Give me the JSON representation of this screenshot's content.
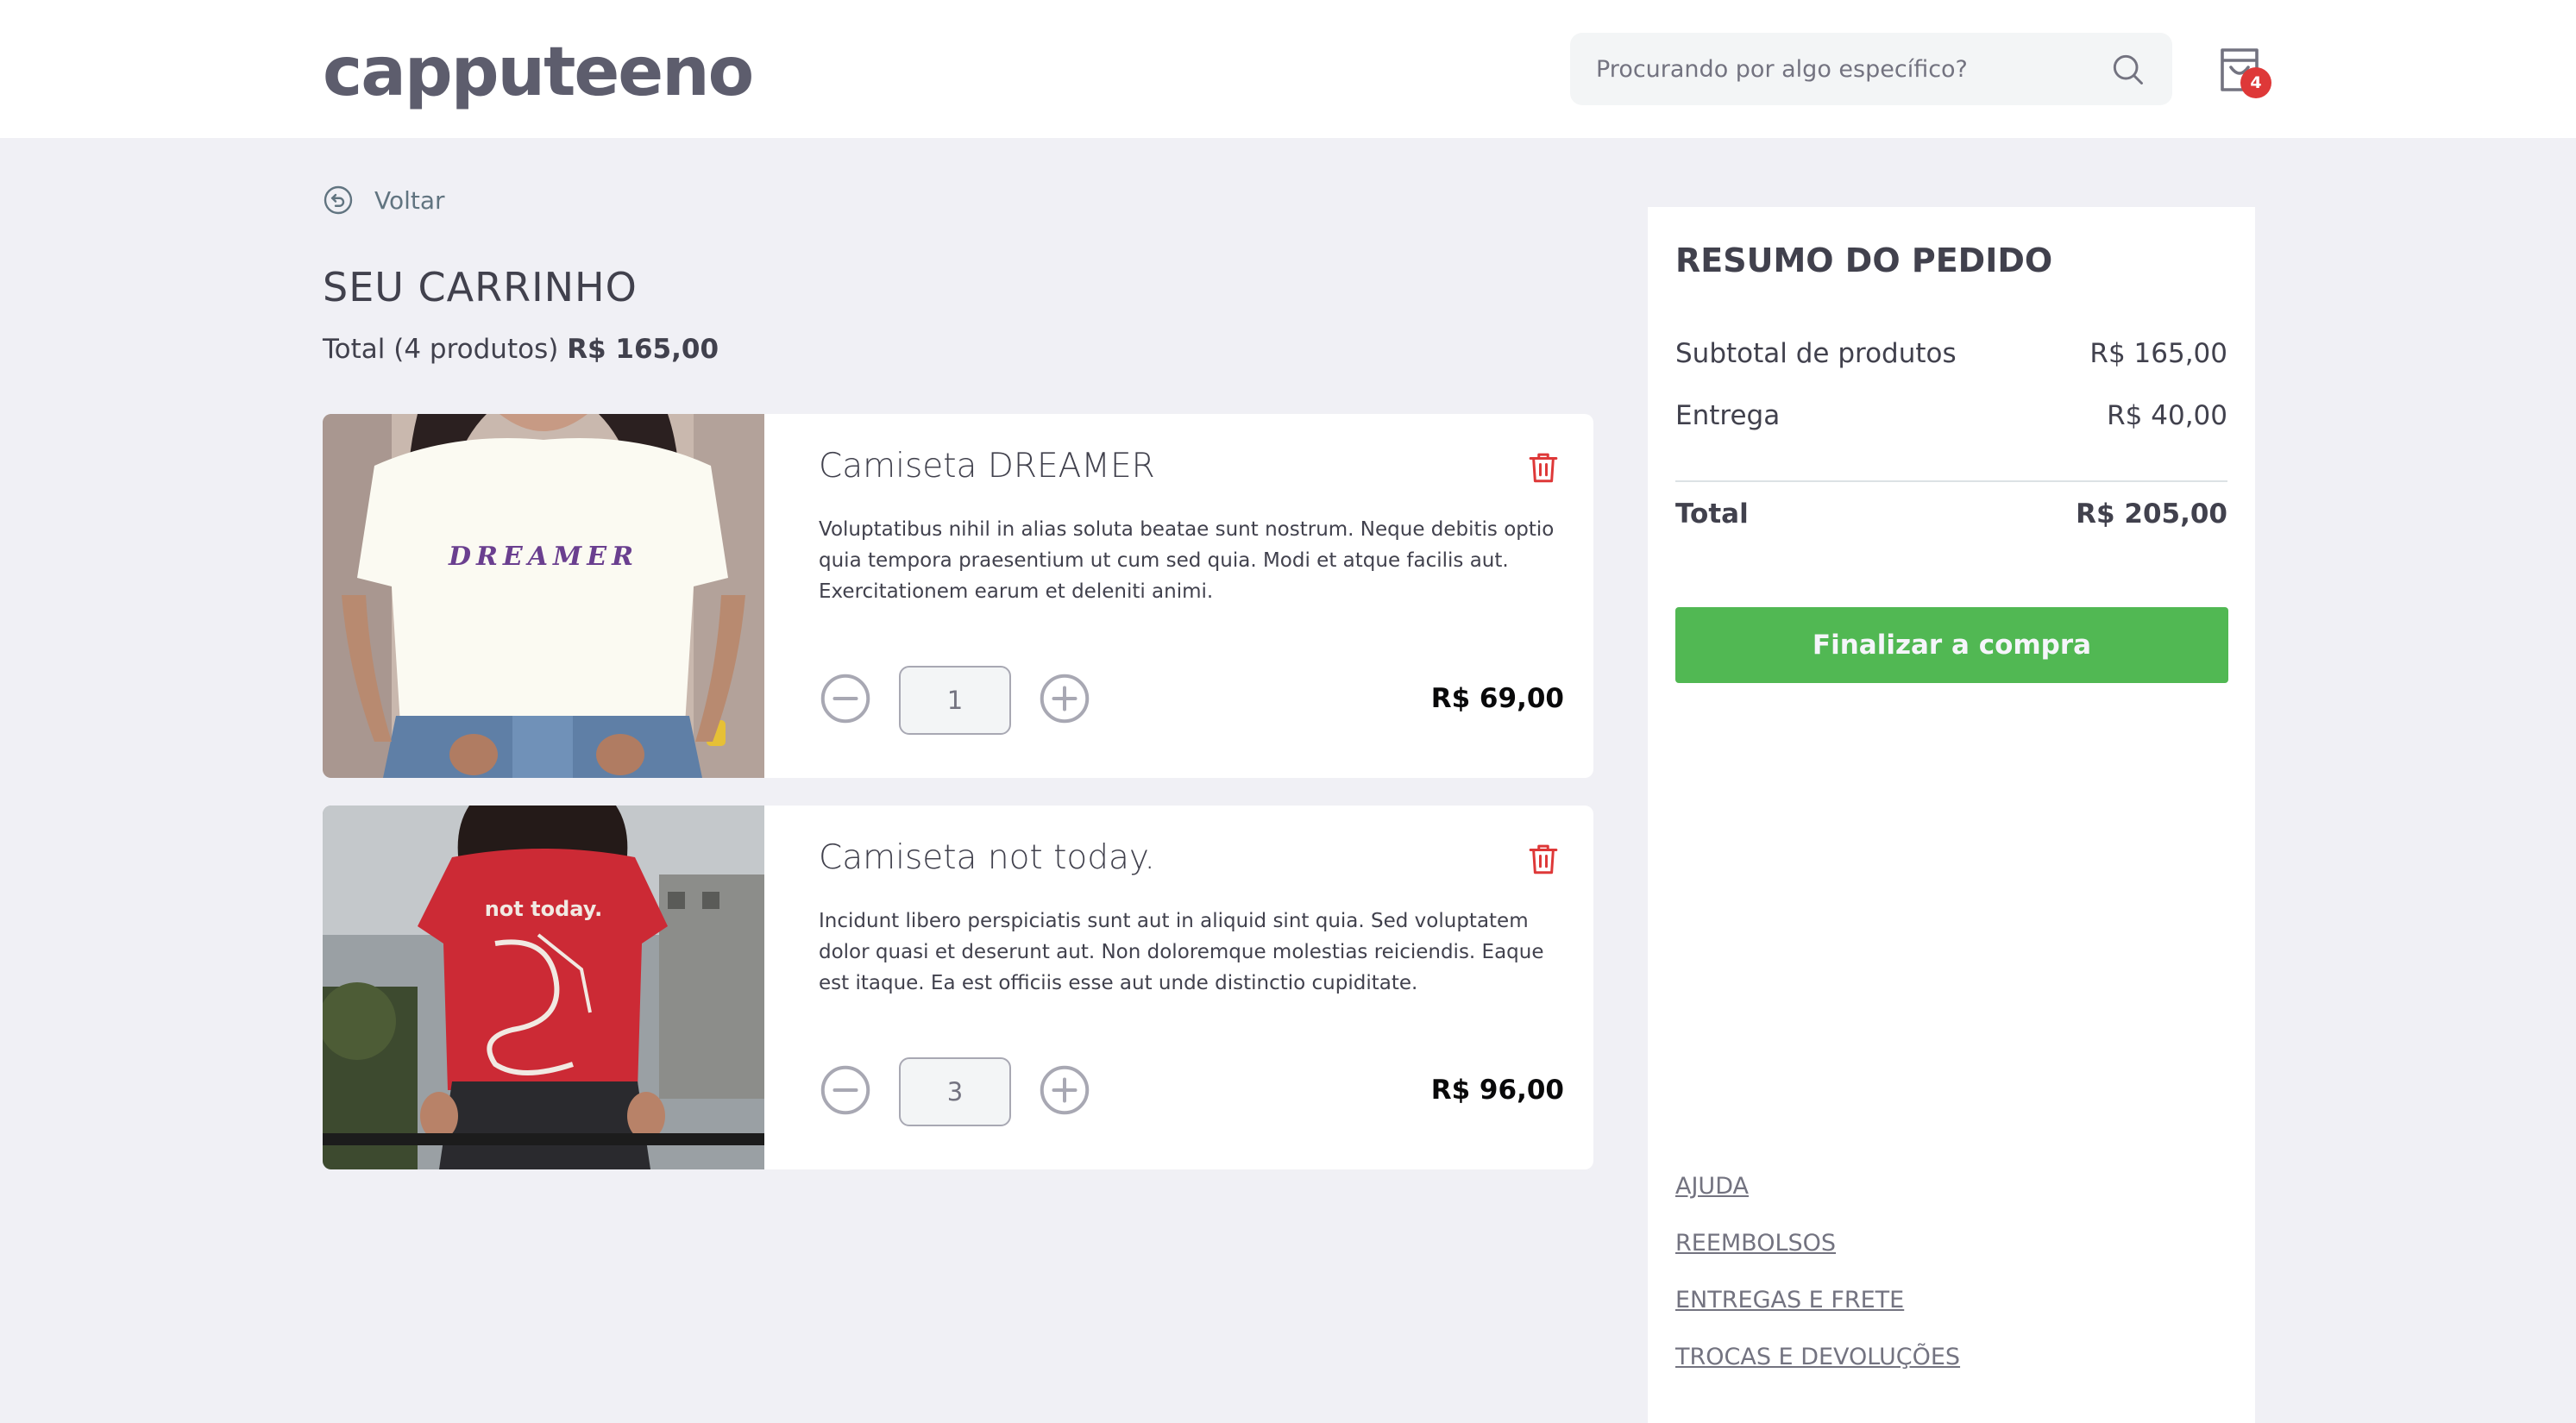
{
  "header": {
    "logo": "capputeeno",
    "search_placeholder": "Procurando por algo específico?",
    "cart_count": "4"
  },
  "back": {
    "label": "Voltar"
  },
  "cart": {
    "title": "SEU CARRINHO",
    "total_prefix": "Total (4 produtos)",
    "total_value": "R$ 165,00",
    "items": [
      {
        "title": "Camiseta DREAMER",
        "description": "Voluptatibus nihil in alias soluta beatae sunt nostrum. Neque debitis optio quia tempora praesentium ut cum sed quia. Modi et atque facilis aut. Exercitationem earum et deleniti animi.",
        "quantity": "1",
        "price": "R$ 69,00",
        "shirt_text": "DREAMER",
        "shirt_color": "#fbfaf2"
      },
      {
        "title": "Camiseta not today.",
        "description": "Incidunt libero perspiciatis sunt aut in aliquid sint quia. Sed voluptatem dolor quasi et deserunt aut. Non doloremque molestias reiciendis. Eaque est itaque. Ea est officiis esse aut unde distinctio cupiditate.",
        "quantity": "3",
        "price": "R$ 96,00",
        "shirt_text": "not today.",
        "shirt_color": "#cc2a35"
      }
    ]
  },
  "summary": {
    "title": "RESUMO DO PEDIDO",
    "subtotal_label": "Subtotal de produtos",
    "subtotal_value": "R$ 165,00",
    "delivery_label": "Entrega",
    "delivery_value": "R$ 40,00",
    "total_label": "Total",
    "total_value": "R$ 205,00",
    "checkout_label": "Finalizar a compra"
  },
  "footer_links": [
    "AJUDA",
    "REEMBOLSOS",
    "ENTREGAS E FRETE",
    "TROCAS E DEVOLUÇÕES"
  ],
  "colors": {
    "accent_green": "#51b853",
    "delete_red": "#de3838",
    "text_dark": "#41414d",
    "background": "#f0f0f5"
  }
}
